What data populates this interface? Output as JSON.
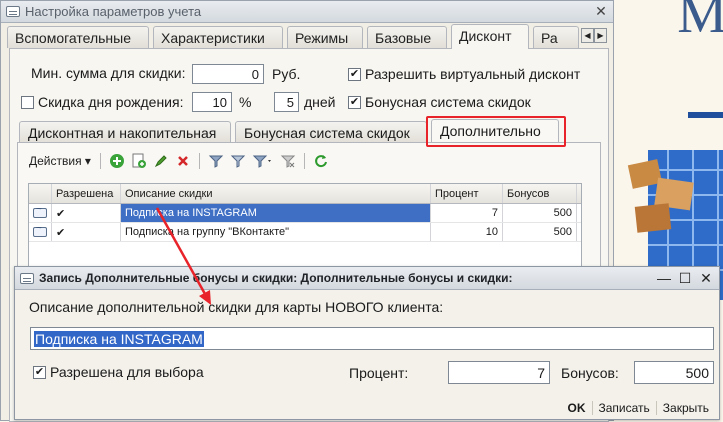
{
  "background": {
    "logo_text": "М"
  },
  "main_window": {
    "title": "Настройка параметров учета",
    "tabs": [
      "Вспомогательные",
      "Характеристики",
      "Режимы",
      "Базовые",
      "Дисконт",
      "Ра"
    ],
    "active_tab": "Дисконт",
    "min_sum_label": "Мин. сумма для скидки:",
    "min_sum_value": "0",
    "min_sum_unit": "Руб.",
    "allow_virtual_label": "Разрешить виртуальный дисконт",
    "allow_virtual_checked": true,
    "birthday_label": "Скидка дня рождения:",
    "birthday_checked": false,
    "birthday_percent": "10",
    "percent_sign": "%",
    "birthday_days": "5",
    "days_label": "дней",
    "bonus_system_label": "Бонусная система скидок",
    "bonus_system_checked": true,
    "inner_tabs": [
      "Дисконтная и накопительная",
      "Бонусная система скидок",
      "Дополнительно"
    ],
    "active_inner_tab": "Дополнительно",
    "toolbar": {
      "actions_label": "Действия"
    },
    "table": {
      "columns": [
        "Разрешена",
        "Описание скидки",
        "Процент",
        "Бонусов"
      ],
      "rows": [
        {
          "allowed": "✔",
          "description": "Подписка на INSTAGRAM",
          "percent": "7",
          "bonus": "500",
          "selected": true
        },
        {
          "allowed": "✔",
          "description": "Подписка на группу \"ВКонтакте\"",
          "percent": "10",
          "bonus": "500",
          "selected": false
        }
      ]
    }
  },
  "record_dialog": {
    "title": "Запись Дополнительные бонусы и скидки: Дополнительные бонусы и скидки:",
    "prompt_label": "Описание дополнительной скидки для карты НОВОГО клиента:",
    "description_value": "Подписка на INSTAGRAM",
    "allowed_label": "Разрешена для выбора",
    "allowed_checked": true,
    "percent_label": "Процент:",
    "percent_value": "7",
    "bonus_label": "Бонусов:",
    "bonus_value": "500",
    "buttons": {
      "ok": "OK",
      "save": "Записать",
      "close": "Закрыть"
    }
  },
  "colors": {
    "highlight": "#e8232a",
    "selection": "#3f6fc4"
  }
}
